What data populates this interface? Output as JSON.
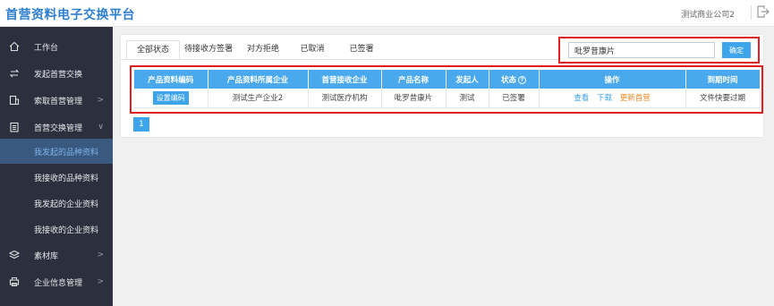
{
  "header": {
    "title": "首营资料电子交换平台",
    "company": "测试商业公司2"
  },
  "sidebar": {
    "items": [
      {
        "label": "工作台",
        "icon": "home-icon"
      },
      {
        "label": "发起首营交换",
        "icon": "exchange-icon"
      },
      {
        "label": "索取首营管理",
        "icon": "request-icon",
        "arrow": ">"
      },
      {
        "label": "首营交换管理",
        "icon": "document-icon",
        "arrow": "∨"
      },
      {
        "label": "素材库",
        "icon": "layers-icon",
        "arrow": ">"
      },
      {
        "label": "企业信息管理",
        "icon": "printer-icon",
        "arrow": ">"
      }
    ],
    "subitems": [
      {
        "label": "我发起的品种资料",
        "active": true
      },
      {
        "label": "我接收的品种资料"
      },
      {
        "label": "我发起的企业资料"
      },
      {
        "label": "我接收的企业资料"
      }
    ]
  },
  "tabs": [
    {
      "label": "全部状态",
      "active": true
    },
    {
      "label": "待接收方签署"
    },
    {
      "label": "对方拒绝"
    },
    {
      "label": "已取消"
    },
    {
      "label": "已签署"
    }
  ],
  "search": {
    "value": "吡罗昔康片",
    "button": "确定"
  },
  "table": {
    "headers": [
      "产品资料编码",
      "产品资料所属企业",
      "首营接收企业",
      "产品名称",
      "发起人",
      "状态",
      "操作",
      "到期时间"
    ],
    "row": {
      "code_button": "设置编码",
      "company": "测试生产企业2",
      "receiver": "测试医疗机构",
      "product": "吡罗昔康片",
      "initiator": "测试",
      "status": "已签署",
      "actions": [
        "查看",
        "下载",
        "更新首营"
      ],
      "expiry": "文件快要过期"
    }
  },
  "pager": {
    "current": "1"
  }
}
